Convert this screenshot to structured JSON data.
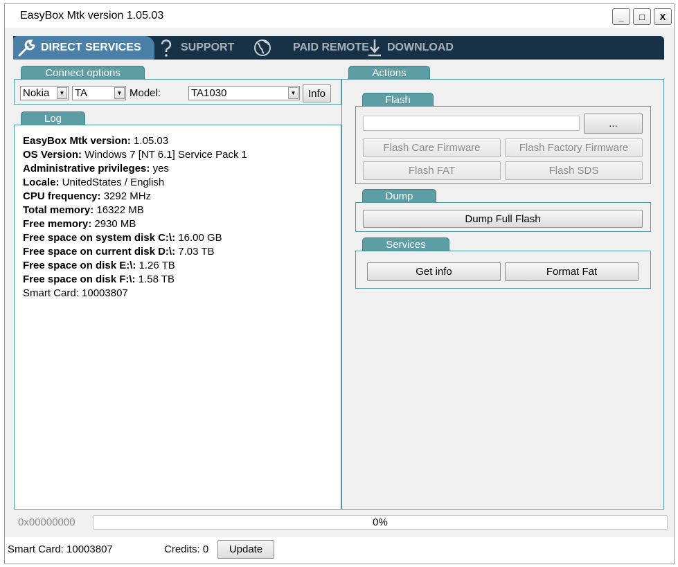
{
  "window": {
    "title": "EasyBox Mtk version 1.05.03",
    "minimize_label": "_",
    "maximize_label": "□",
    "close_label": "X"
  },
  "nav": {
    "tabs": [
      {
        "label": "DIRECT SERVICES",
        "icon": "wrench-icon",
        "active": true
      },
      {
        "label": "SUPPORT",
        "icon": "question-icon",
        "active": false
      },
      {
        "label": "PAID REMOTE",
        "icon": "globe-icon",
        "active": false
      },
      {
        "label": "DOWNLOAD",
        "icon": "download-icon",
        "active": false
      }
    ]
  },
  "connect": {
    "title": "Connect options",
    "brand": "Nokia",
    "series": "TA",
    "model_label": "Model:",
    "model": "TA1030",
    "info_label": "Info"
  },
  "log": {
    "title": "Log",
    "lines": [
      {
        "key": "EasyBox Mtk version:",
        "value": " 1.05.03"
      },
      {
        "key": "OS Version:",
        "value": " Windows 7 [NT 6.1] Service Pack 1"
      },
      {
        "key": "Administrative privileges:",
        "value": " yes"
      },
      {
        "key": "Locale:",
        "value": " UnitedStates / English"
      },
      {
        "key": "CPU frequency:",
        "value": " 3292 MHz"
      },
      {
        "key": "Total memory:",
        "value": " 16322 MB"
      },
      {
        "key": "Free memory:",
        "value": " 2930 MB"
      },
      {
        "key": "Free space on system disk C:\\:",
        "value": " 16.00 GB"
      },
      {
        "key": "Free space on current disk D:\\:",
        "value": " 7.03 TB"
      },
      {
        "key": "Free space on disk E:\\:",
        "value": " 1.26 TB"
      },
      {
        "key": "Free space on disk F:\\:",
        "value": " 1.58 TB"
      },
      {
        "key": "",
        "value": "Smart Card: 10003807"
      }
    ]
  },
  "actions": {
    "title": "Actions",
    "flash": {
      "title": "Flash",
      "path_value": "",
      "browse_label": "...",
      "care_label": "Flash Care Firmware",
      "factory_label": "Flash Factory Firmware",
      "fat_label": "Flash FAT",
      "sds_label": "Flash SDS"
    },
    "dump": {
      "title": "Dump",
      "full_label": "Dump Full Flash"
    },
    "services": {
      "title": "Services",
      "getinfo_label": "Get info",
      "formatfat_label": "Format Fat"
    }
  },
  "progress": {
    "address": "0x00000000",
    "text": "0%",
    "value": 0
  },
  "status": {
    "smartcard": "Smart Card: 10003807",
    "credits": "Credits: 0",
    "update_label": "Update"
  }
}
